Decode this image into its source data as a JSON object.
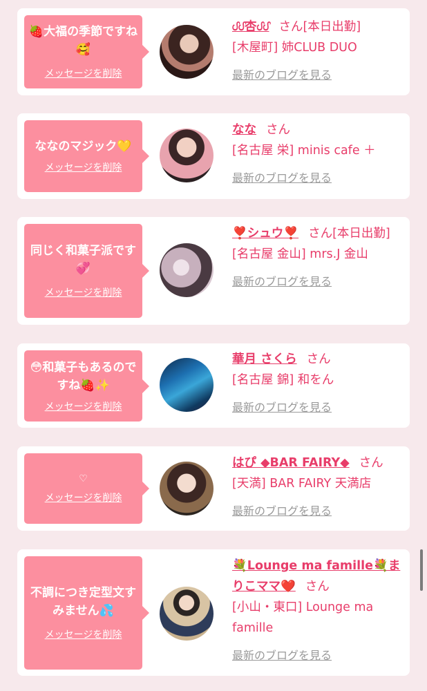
{
  "delete_label": "メッセージを削除",
  "blog_label": "最新のブログを見る",
  "san_label": "さん",
  "colors": {
    "accent": "#e83d6a",
    "bubble": "#fc8f9f",
    "background": "#f7e9ec"
  },
  "cards": [
    {
      "message": "🍓大福の季節ですね🥰",
      "name": "ᦔᦔ杏ᦔᦔ",
      "area": "[木屋町] 姉CLUB DUO"
    },
    {
      "message": "ななのマジック💛",
      "name": "なな",
      "area": "[名古屋 栄] minis cafe ＋"
    },
    {
      "message": "同じく和菓子派です💞",
      "name": "❣️シュウ❣️",
      "area": "[名古屋 金山] mrs.J 金山",
      "suffix": "本日出勤"
    },
    {
      "message": "😳和菓子もあるのですね🍓✨",
      "name": "華月 さくら",
      "area": "[名古屋 錦] 和をん"
    },
    {
      "message": "♡",
      "name": "はぴ ◆BAR FAIRY◆",
      "area": "[天満] BAR FAIRY 天満店"
    },
    {
      "message": "不調につき定型文すみません💦",
      "name": "💐Lounge ma famille💐まりこママ❤️",
      "area": "[小山・東口] Lounge ma famille"
    }
  ],
  "status_text": "[本日出勤]"
}
